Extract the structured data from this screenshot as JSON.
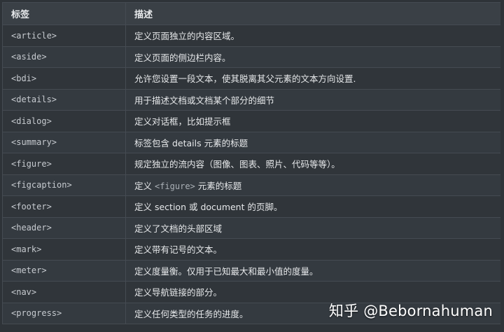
{
  "table": {
    "headers": [
      "标签",
      "描述"
    ],
    "rows": [
      {
        "tag": "<article>",
        "desc": "定义页面独立的内容区域。"
      },
      {
        "tag": "<aside>",
        "desc": "定义页面的侧边栏内容。"
      },
      {
        "tag": "<bdi>",
        "desc": "允许您设置一段文本，使其脱离其父元素的文本方向设置."
      },
      {
        "tag": "<details>",
        "desc": "用于描述文档或文档某个部分的细节"
      },
      {
        "tag": "<dialog>",
        "desc": "定义对话框，比如提示框"
      },
      {
        "tag": "<summary>",
        "desc": "标签包含 details 元素的标题"
      },
      {
        "tag": "<figure>",
        "desc": "规定独立的流内容（图像、图表、照片、代码等等）。"
      },
      {
        "tag": "<figcaption>",
        "desc_prefix": "定义 ",
        "desc_code": "<figure>",
        "desc_suffix": " 元素的标题"
      },
      {
        "tag": "<footer>",
        "desc": "定义 section 或 document 的页脚。"
      },
      {
        "tag": "<header>",
        "desc": "定义了文档的头部区域"
      },
      {
        "tag": "<mark>",
        "desc": "定义带有记号的文本。"
      },
      {
        "tag": "<meter>",
        "desc": "定义度量衡。仅用于已知最大和最小值的度量。"
      },
      {
        "tag": "<nav>",
        "desc": "定义导航链接的部分。"
      },
      {
        "tag": "<progress>",
        "desc": "定义任何类型的任务的进度。"
      }
    ]
  },
  "watermark": "知乎 @Bebornahuman",
  "colors": {
    "background": "#2e3338",
    "header_bg": "#3a4046",
    "border": "#454b52",
    "text": "#e6e8ea"
  }
}
